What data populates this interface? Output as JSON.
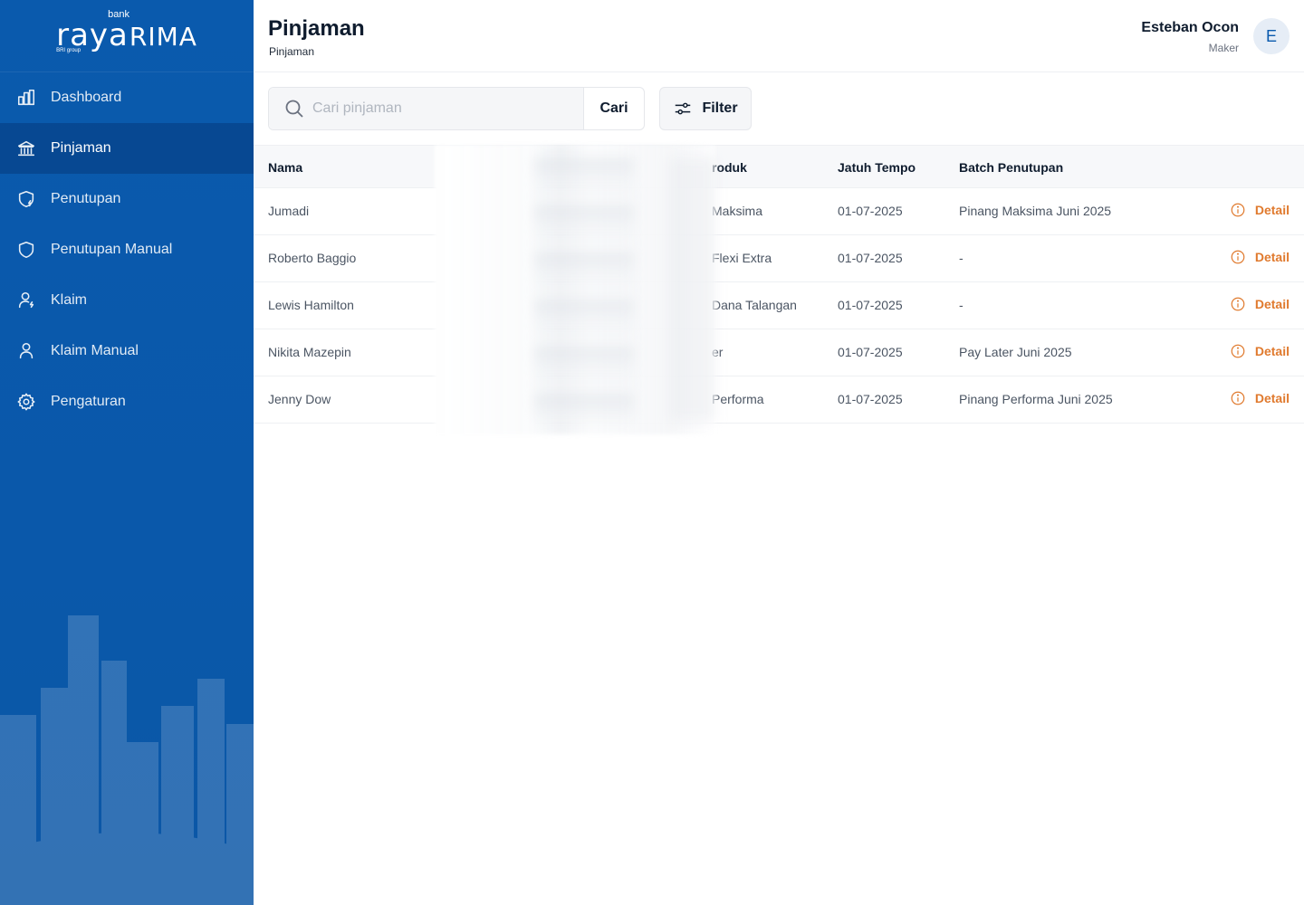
{
  "brand": {
    "bank": "bank",
    "raya": "raya",
    "rima": "RIMA",
    "group": "BRI group"
  },
  "sidebar": {
    "items": [
      {
        "label": "Dashboard",
        "icon": "chart-bar-icon",
        "active": false
      },
      {
        "label": "Pinjaman",
        "icon": "bank-building-icon",
        "active": true
      },
      {
        "label": "Penutupan",
        "icon": "shield-bolt-icon",
        "active": false
      },
      {
        "label": "Penutupan Manual",
        "icon": "shield-icon",
        "active": false
      },
      {
        "label": "Klaim",
        "icon": "user-bolt-icon",
        "active": false
      },
      {
        "label": "Klaim Manual",
        "icon": "user-icon",
        "active": false
      },
      {
        "label": "Pengaturan",
        "icon": "gear-icon",
        "active": false
      }
    ]
  },
  "header": {
    "title": "Pinjaman",
    "breadcrumb": "Pinjaman",
    "user_name": "Esteban Ocon",
    "user_role": "Maker",
    "avatar_initial": "E"
  },
  "toolbar": {
    "search_placeholder": "Cari pinjaman",
    "search_value": "",
    "search_button": "Cari",
    "filter_button": "Filter"
  },
  "table": {
    "columns": {
      "nama": "Nama",
      "produk": "roduk",
      "tempo": "Jatuh Tempo",
      "batch": "Batch Penutupan"
    },
    "action_label": "Detail",
    "rows": [
      {
        "nama": "Jumadi",
        "produk": "Maksima",
        "tempo": "01-07-2025",
        "batch": "Pinang Maksima Juni 2025"
      },
      {
        "nama": "Roberto Baggio",
        "produk": "Flexi Extra",
        "tempo": "01-07-2025",
        "batch": "-"
      },
      {
        "nama": "Lewis Hamilton",
        "produk": "Dana Talangan",
        "tempo": "01-07-2025",
        "batch": "-"
      },
      {
        "nama": "Nikita Mazepin",
        "produk": "er",
        "tempo": "01-07-2025",
        "batch": "Pay Later Juni 2025"
      },
      {
        "nama": "Jenny Dow",
        "produk": "Performa",
        "tempo": "01-07-2025",
        "batch": "Pinang Performa Juni 2025"
      }
    ]
  },
  "colors": {
    "sidebar": "#0a5aad",
    "accent": "#e07a2e",
    "heading": "#0f1c2e"
  }
}
